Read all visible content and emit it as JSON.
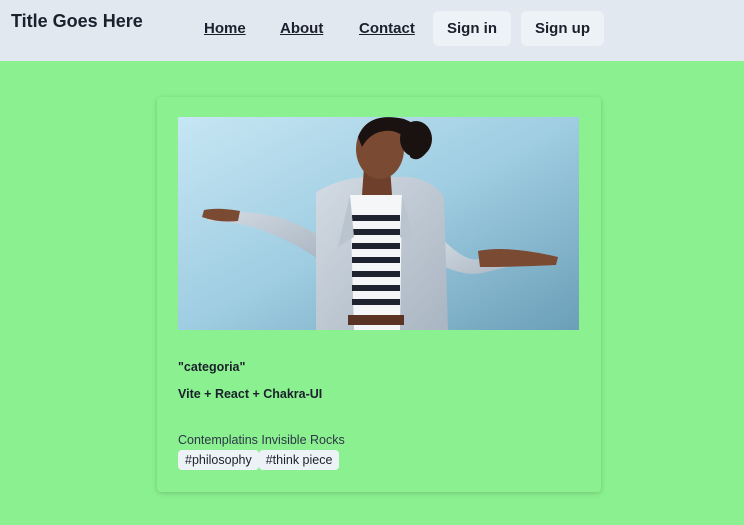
{
  "header": {
    "title": "Title Goes Here",
    "nav": [
      {
        "label": "Home"
      },
      {
        "label": "About"
      },
      {
        "label": "Contact"
      }
    ],
    "sign_in": "Sign in",
    "sign_up": "Sign up"
  },
  "card": {
    "image_alt": "woman shrugging",
    "category": "\"categoria\"",
    "heading": "Vite + React + Chakra-UI",
    "text": "Contemplatins Invisible Rocks",
    "tags": [
      "#philosophy",
      "#think piece"
    ]
  },
  "colors": {
    "page_background": "#8bf08f",
    "header_background": "#e2e8f0",
    "button_background": "#edf2f7"
  }
}
